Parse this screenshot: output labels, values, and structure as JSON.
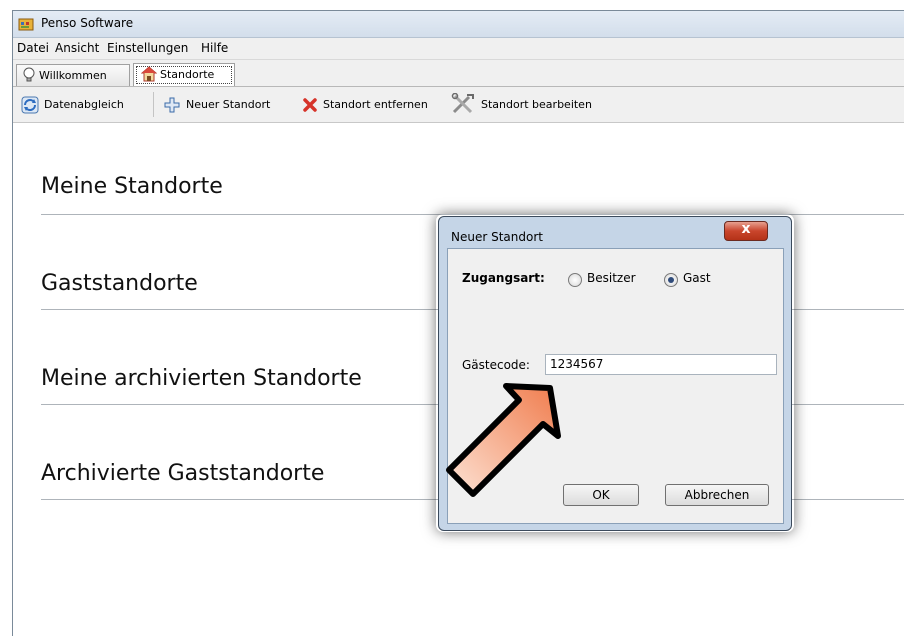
{
  "window": {
    "title": "Penso Software"
  },
  "menu": [
    {
      "label": "Datei"
    },
    {
      "label": "Ansicht"
    },
    {
      "label": "Einstellungen"
    },
    {
      "label": "Hilfe"
    }
  ],
  "tabs": [
    {
      "label": "Willkommen",
      "icon": "lightbulb-icon"
    },
    {
      "label": "Standorte",
      "icon": "house-icon"
    }
  ],
  "toolbar": {
    "sync_label": "Datenabgleich",
    "new_label": "Neuer Standort",
    "remove_label": "Standort entfernen",
    "edit_label": "Standort bearbeiten"
  },
  "sections": [
    {
      "title": "Meine Standorte"
    },
    {
      "title": "Gaststandorte"
    },
    {
      "title": "Meine archivierten Standorte"
    },
    {
      "title": "Archivierte Gaststandorte"
    }
  ],
  "dialog": {
    "title": "Neuer Standort",
    "close_symbol": "x",
    "access_label": "Zugangsart:",
    "options": [
      {
        "label": "Besitzer",
        "selected": false
      },
      {
        "label": "Gast",
        "selected": true
      }
    ],
    "guest_code_label": "Gästecode:",
    "guest_code_value": "1234567",
    "ok_label": "OK",
    "cancel_label": "Abbrechen"
  },
  "colors": {
    "arrow_fill": "#f08a5e",
    "close_button": "#c9452c",
    "dialog_frame": "#c5d5e7"
  }
}
